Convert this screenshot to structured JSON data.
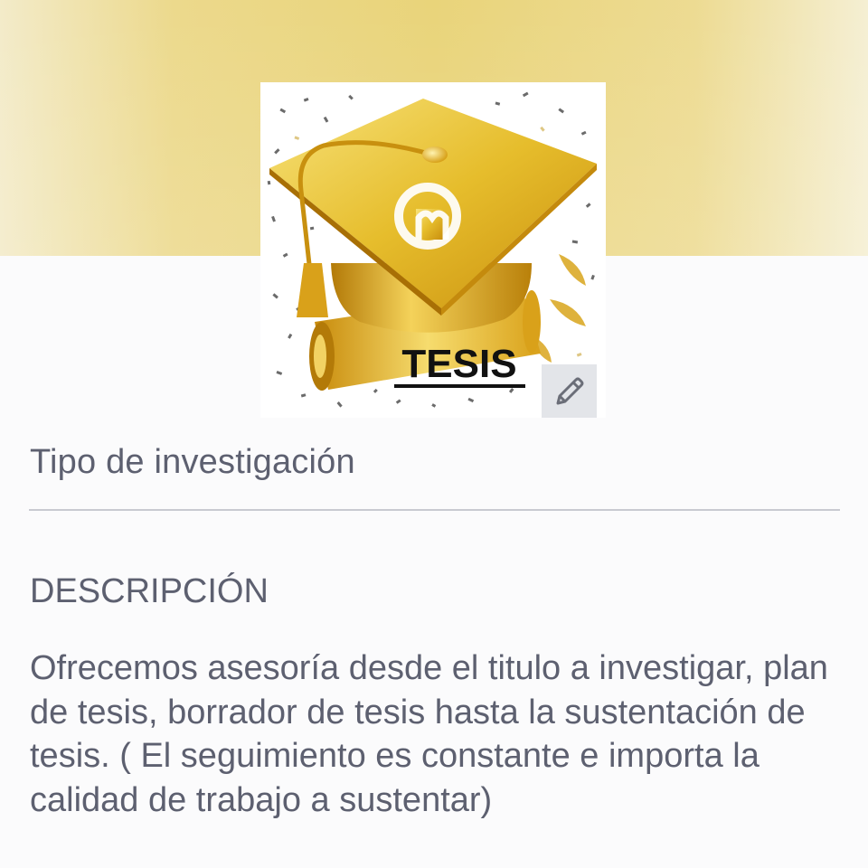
{
  "profile": {
    "image_caption": "TESIS",
    "logo_letters": "gm",
    "category": "Tipo de investigación"
  },
  "description": {
    "heading": "DESCRIPCIÓN",
    "text": "Ofrecemos asesoría desde el titulo a investigar, plan de tesis, borrador de tesis hasta la sustentación de tesis. ( El seguimiento es constante e importa la calidad de trabajo a sustentar)"
  },
  "icons": {
    "edit": "pencil-icon",
    "image": "graduation-cap-icon"
  },
  "colors": {
    "cover_gold": "#e9d47a",
    "text_gray": "#5d6070",
    "divider": "#c8cad1",
    "edit_button_bg": "#e3e5e9"
  }
}
